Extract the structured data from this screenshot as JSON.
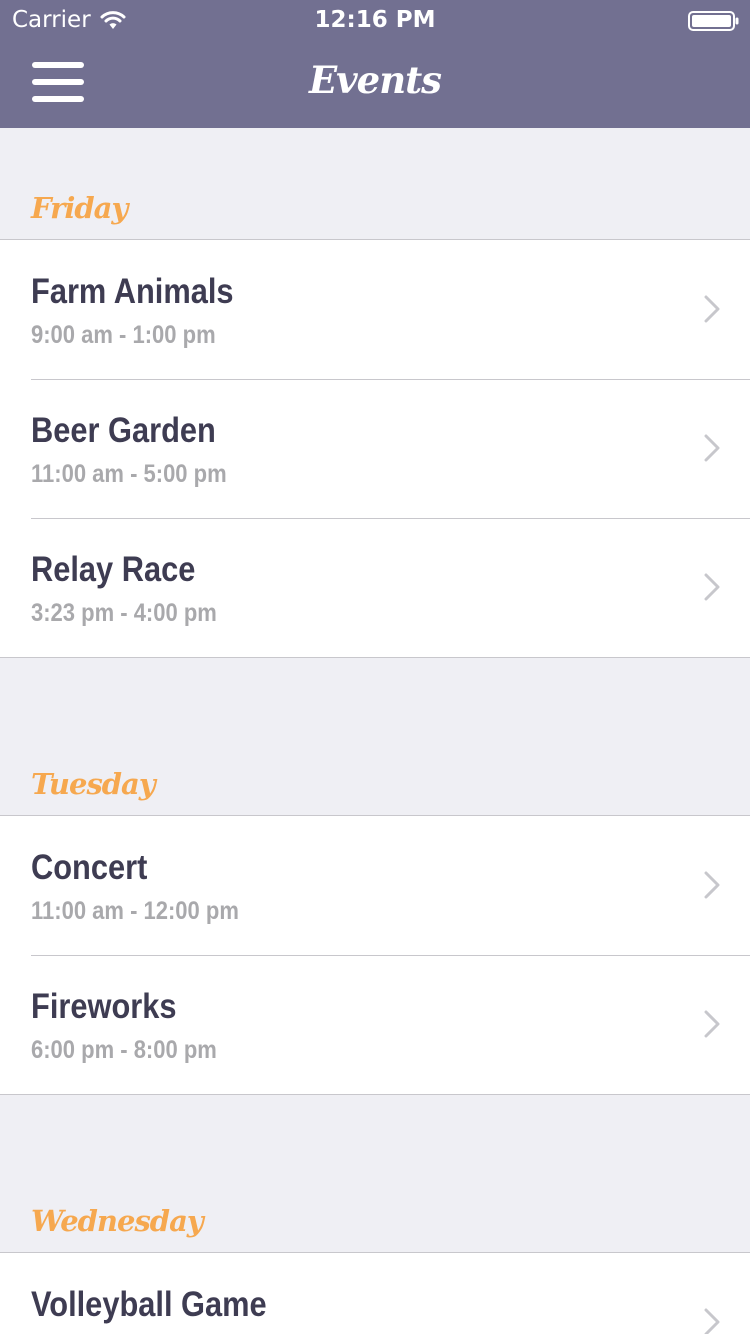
{
  "status_bar": {
    "carrier": "Carrier",
    "time": "12:16 PM",
    "icons": [
      "wifi-icon",
      "battery-icon"
    ]
  },
  "nav": {
    "title": "Events",
    "menu_icon": "hamburger-menu-icon"
  },
  "colors": {
    "nav_background": "#727091",
    "section_title": "#f6a84f",
    "event_title": "#3e3c52",
    "event_time": "#a9a9ac",
    "background": "#efeff4"
  },
  "sections": [
    {
      "title": "Friday",
      "events": [
        {
          "title": "Farm Animals",
          "time": "9:00 am - 1:00 pm"
        },
        {
          "title": "Beer Garden",
          "time": "11:00 am - 5:00 pm"
        },
        {
          "title": "Relay Race",
          "time": "3:23 pm - 4:00 pm"
        }
      ]
    },
    {
      "title": "Tuesday",
      "events": [
        {
          "title": "Concert",
          "time": "11:00 am - 12:00 pm"
        },
        {
          "title": "Fireworks",
          "time": "6:00 pm - 8:00 pm"
        }
      ]
    },
    {
      "title": "Wednesday",
      "events": [
        {
          "title": "Volleyball Game",
          "time": ""
        }
      ]
    }
  ]
}
